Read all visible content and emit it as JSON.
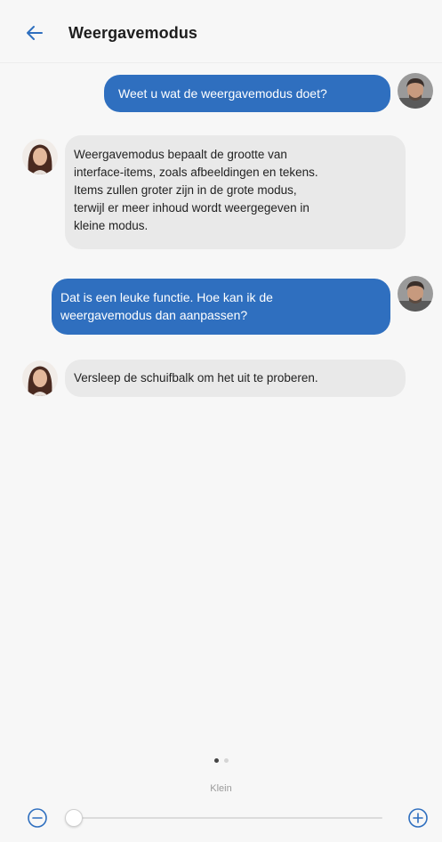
{
  "header": {
    "back_icon": "arrow-left-icon",
    "title": "Weergavemodus"
  },
  "colors": {
    "accent": "#2f6fbf",
    "incoming_bubble": "#e9e9e9",
    "background": "#f7f7f7"
  },
  "messages": [
    {
      "sender": "user",
      "avatar": "avatar-man",
      "text": "Weet u wat de weergavemodus doet?"
    },
    {
      "sender": "assistant",
      "avatar": "avatar-woman",
      "text": "Weergavemodus bepaalt de grootte van\ninterface-items, zoals afbeeldingen en tekens.\nItems zullen groter zijn in de grote modus,\nterwijl er meer inhoud wordt weergegeven in\nkleine modus."
    },
    {
      "sender": "user",
      "avatar": "avatar-man",
      "text": "Dat is een leuke functie. Hoe kan ik de\nweergavemodus dan aanpassen?"
    },
    {
      "sender": "assistant",
      "avatar": "avatar-woman",
      "text": "Versleep de schuifbalk om het uit te proberen."
    }
  ],
  "pager": {
    "pages": 2,
    "current": 1
  },
  "display_size": {
    "label": "Klein",
    "level": 0.0,
    "minus_icon": "minus-circle-icon",
    "plus_icon": "plus-circle-icon"
  }
}
